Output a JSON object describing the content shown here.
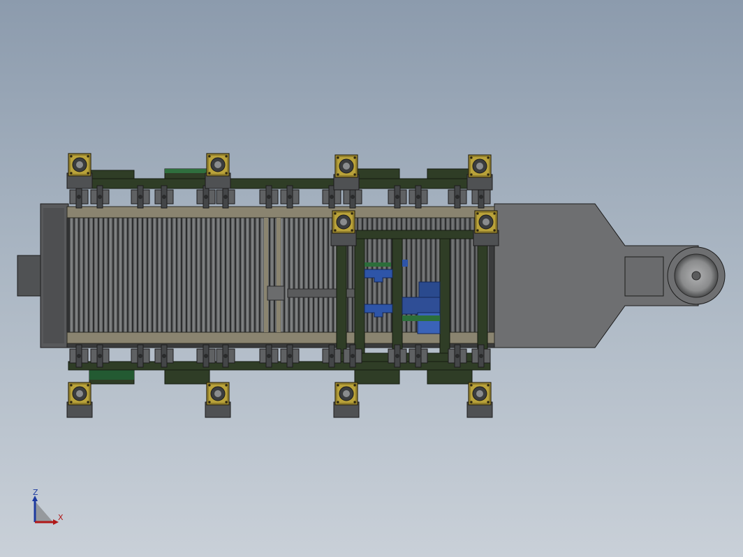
{
  "viewport": {
    "background_top": "#8c9bad",
    "background_bottom": "#c9d0d8"
  },
  "colors": {
    "frame_green": "#2f3d26",
    "frame_edge": "#141a10",
    "bearing_gold": "#b9a23a",
    "housing_gray": "#5c5e60",
    "roller_gray": "#6b6d6e",
    "rail_tan": "#8a8470",
    "motor_blue": "#2e55a8",
    "axis_x": "#b01818",
    "axis_z": "#1d3aa0"
  },
  "triad": {
    "x_label": "X",
    "z_label": "Z"
  },
  "icons": {
    "bearing": "flange-bearing-icon",
    "motor": "motor-icon",
    "triad": "axis-triad-icon"
  }
}
